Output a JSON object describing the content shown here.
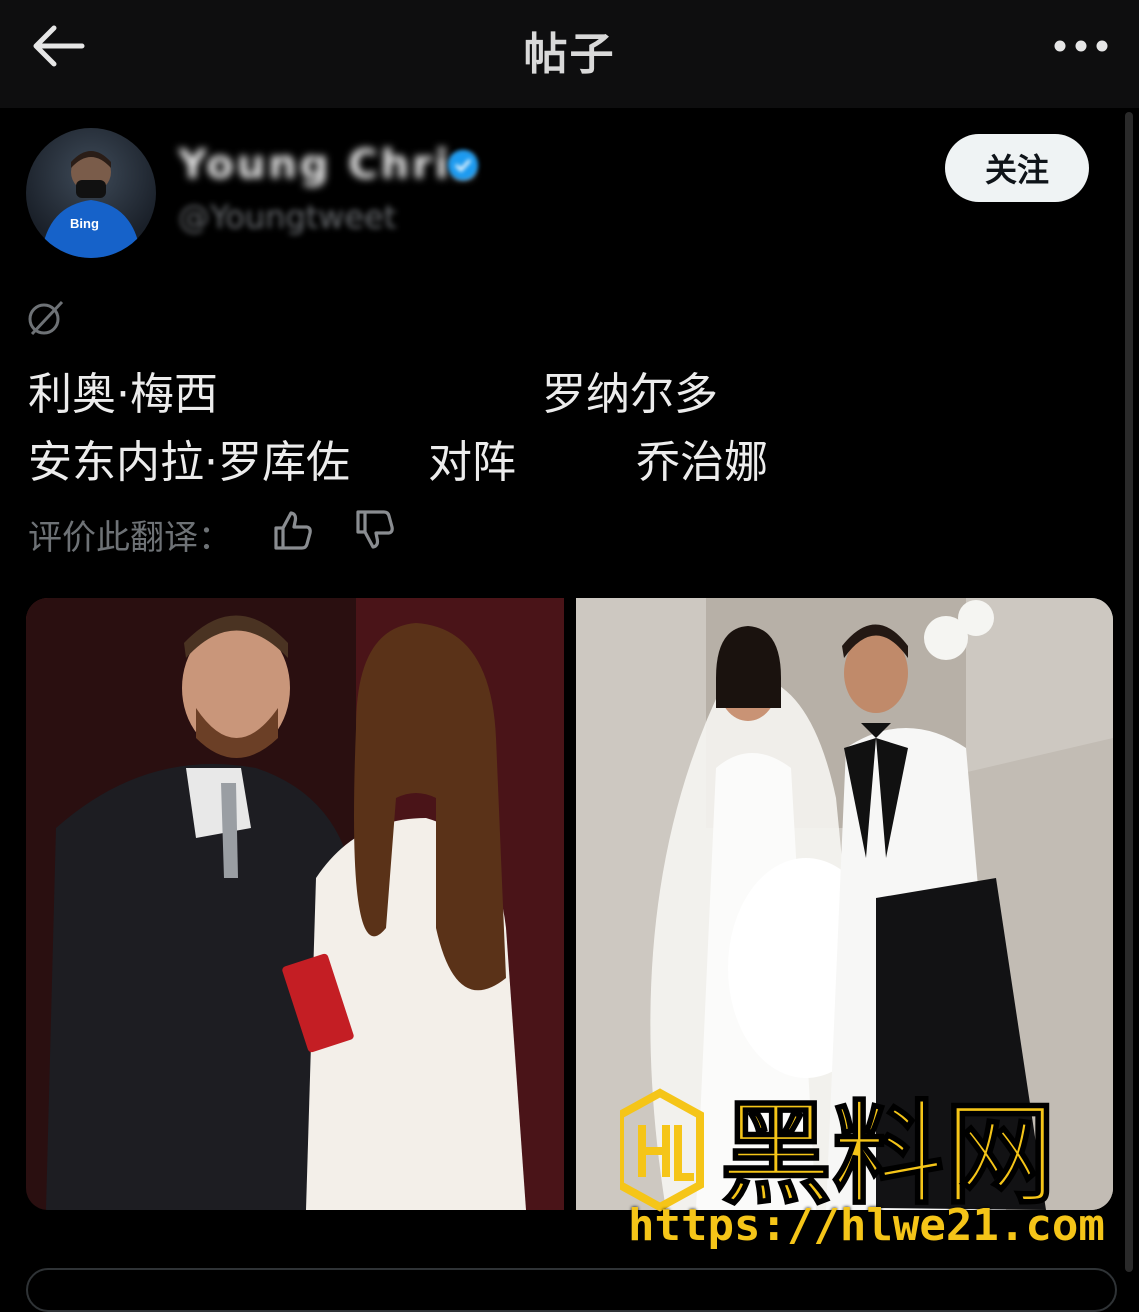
{
  "header": {
    "title": "帖子",
    "back_icon": "arrow-left-icon",
    "more_icon": "more-horizontal-icon"
  },
  "author": {
    "display_name": "Young Chris",
    "handle": "@Youngtweet",
    "follow_label": "关注",
    "verified_color": "#1d9bf0"
  },
  "post": {
    "translate_icon": "translate-icon",
    "line1_a": "利奥·梅西",
    "line1_b": "罗纳尔多",
    "line2_a": "安东内拉·罗库佐",
    "line2_b": "对阵",
    "line2_c": "乔治娜",
    "rate_label": "评价此翻译：",
    "thumb_up_icon": "thumb-up-icon",
    "thumb_down_icon": "thumb-down-icon"
  },
  "media": {
    "left_photo": "wedding-photo-couple-1",
    "right_photo": "wedding-photo-couple-2"
  },
  "watermark": {
    "logo_text": "黑料网",
    "url": "https://hlwe21.com",
    "color": "#f5c518"
  }
}
